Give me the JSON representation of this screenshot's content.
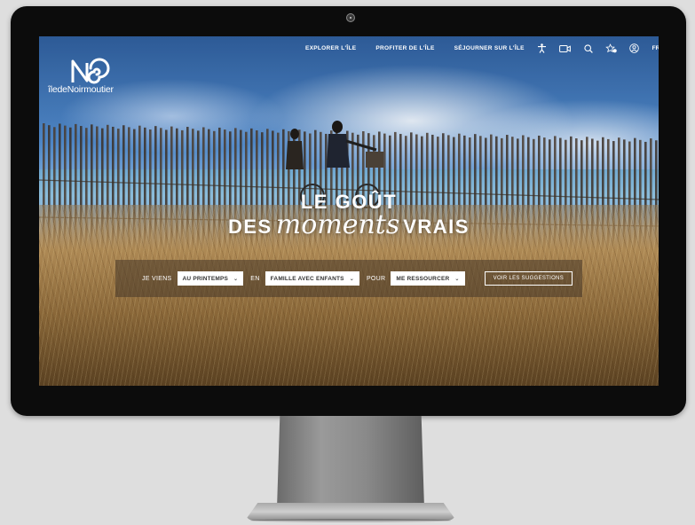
{
  "brand": {
    "name": "îledeNoirmoutier"
  },
  "nav": {
    "items": [
      {
        "label": "EXPLORER L'ÎLE"
      },
      {
        "label": "PROFITER DE L'ÎLE"
      },
      {
        "label": "SÉJOURNER SUR L'ÎLE"
      }
    ]
  },
  "header_icons": [
    {
      "name": "accessibility-icon"
    },
    {
      "name": "live-camera-icon"
    },
    {
      "name": "search-icon"
    },
    {
      "name": "favorites-icon"
    },
    {
      "name": "account-icon"
    },
    {
      "name": "language-icon",
      "label": "FR"
    }
  ],
  "hero": {
    "line1": "LE GOÛT",
    "line2_start": "DES",
    "line2_script": "moments",
    "line2_end": "VRAIS"
  },
  "selector": {
    "label_come": "JE VIENS",
    "season": "AU PRINTEMPS",
    "label_with": "EN",
    "company": "FAMILLE AVEC ENFANTS",
    "label_for": "POUR",
    "purpose": "ME RESSOURCER",
    "cta": "VOIR LES SUGGESTIONS"
  },
  "colors": {
    "bezel": "#0c0c0c",
    "accent_white": "#ffffff",
    "selector_bg": "#463728"
  }
}
